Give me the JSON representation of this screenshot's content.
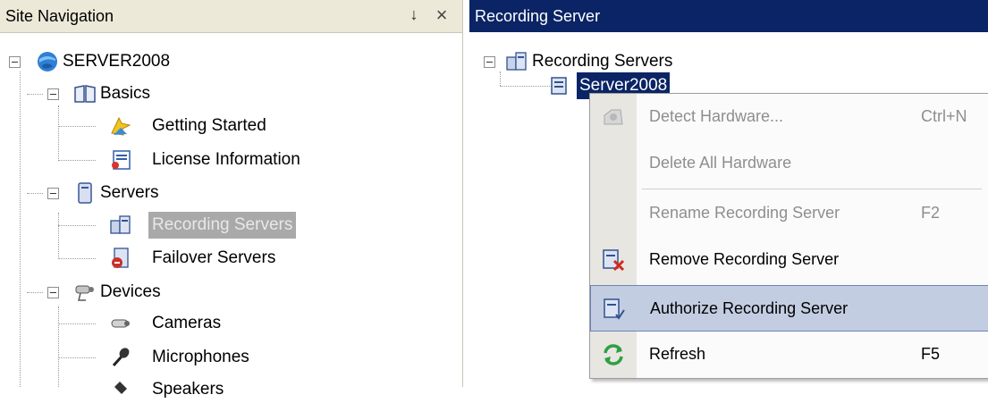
{
  "site_nav": {
    "title": "Site Navigation",
    "pin_glyph": "↓",
    "close_glyph": "×",
    "tree": {
      "server": "SERVER2008",
      "basics": "Basics",
      "getting_started": "Getting Started",
      "license_information": "License Information",
      "servers": "Servers",
      "recording_servers": "Recording Servers",
      "failover_servers": "Failover Servers",
      "devices": "Devices",
      "cameras": "Cameras",
      "microphones": "Microphones",
      "speakers": "Speakers"
    }
  },
  "recording_pane": {
    "title": "Recording Server",
    "tree": {
      "root": "Recording Servers",
      "child": "Server2008"
    }
  },
  "context_menu": {
    "items": [
      {
        "label": "Detect Hardware...",
        "shortcut": "Ctrl+N",
        "enabled": false
      },
      {
        "label": "Delete All Hardware",
        "shortcut": "",
        "enabled": false
      },
      {
        "label": "Rename Recording Server",
        "shortcut": "F2",
        "enabled": false
      },
      {
        "label": "Remove Recording Server",
        "shortcut": "",
        "enabled": true
      },
      {
        "label": "Authorize Recording Server",
        "shortcut": "",
        "enabled": true,
        "highlighted": true
      },
      {
        "label": "Refresh",
        "shortcut": "F5",
        "enabled": true
      }
    ]
  },
  "colors": {
    "active_title_bar": "#0a2465",
    "inactive_title_bar": "#ece9d8",
    "menu_highlight": "#c3cde2",
    "selected_tree_item": "#a9a9a9"
  }
}
